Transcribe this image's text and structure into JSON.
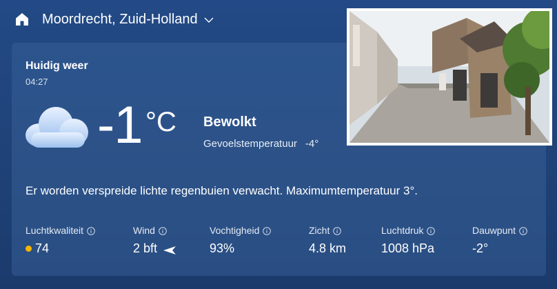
{
  "header": {
    "location": "Moordrecht, Zuid-Holland"
  },
  "current": {
    "title": "Huidig weer",
    "time": "04:27",
    "temperature": "-1",
    "unit": "°C",
    "condition": "Bewolkt",
    "feels_like_label": "Gevoelstemperatuur",
    "feels_like_value": "-4°",
    "summary": "Er worden verspreide lichte regenbuien verwacht. Maximumtemperatuur 3°."
  },
  "metrics": [
    {
      "label": "Luchtkwaliteit",
      "value": "74"
    },
    {
      "label": "Wind",
      "value": "2 bft"
    },
    {
      "label": "Vochtigheid",
      "value": "93%"
    },
    {
      "label": "Zicht",
      "value": "4.8 km"
    },
    {
      "label": "Luchtdruk",
      "value": "1008 hPa"
    },
    {
      "label": "Dauwpunt",
      "value": "-2°"
    }
  ],
  "icons": {
    "home": "home-icon",
    "chevron": "chevron-down-icon",
    "cloud": "cloud-icon",
    "info": "info-icon",
    "wind_direction": "wind-direction-icon"
  },
  "colors": {
    "air_quality_dot": "#f5b400"
  }
}
